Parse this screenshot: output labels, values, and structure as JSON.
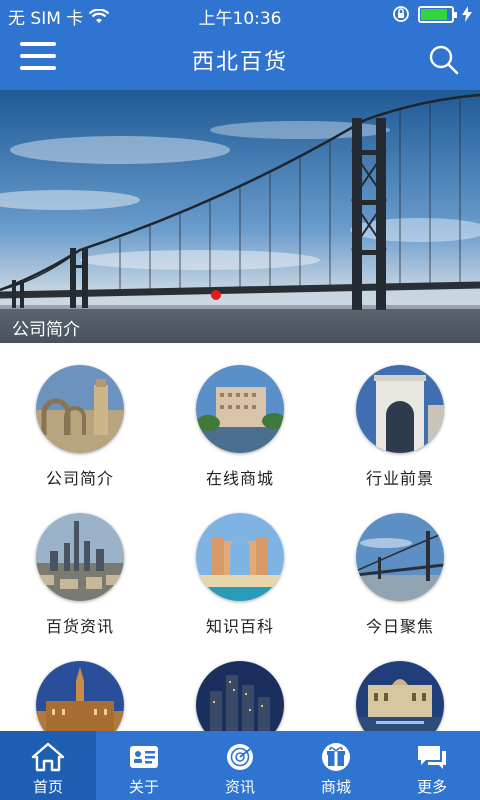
{
  "status": {
    "carrier": "无 SIM 卡",
    "time": "上午10:36",
    "battery_level": 0.85
  },
  "header": {
    "title": "西北百货",
    "menu_icon": "hamburger-menu-icon",
    "search_icon": "search-icon"
  },
  "banner": {
    "caption": "公司简介",
    "active_slide": 1
  },
  "grid": [
    {
      "label": "公司简介",
      "image": "arches-and-tower"
    },
    {
      "label": "在线商城",
      "image": "waterfront-hotel"
    },
    {
      "label": "行业前景",
      "image": "white-arch-building"
    },
    {
      "label": "百货资讯",
      "image": "city-skyline"
    },
    {
      "label": "知识百科",
      "image": "resort-beach"
    },
    {
      "label": "今日聚焦",
      "image": "bridge-sky"
    },
    {
      "label": "",
      "image": "gothic-town-hall"
    },
    {
      "label": "",
      "image": "night-skyscrapers"
    },
    {
      "label": "",
      "image": "palace-fountain"
    }
  ],
  "tabs": [
    {
      "label": "首页",
      "icon": "home-icon"
    },
    {
      "label": "关于",
      "icon": "id-card-icon"
    },
    {
      "label": "资讯",
      "icon": "radar-icon"
    },
    {
      "label": "商城",
      "icon": "gift-icon"
    },
    {
      "label": "更多",
      "icon": "chat-bubbles-icon"
    }
  ],
  "colors": {
    "primary": "#2f74d0",
    "primary_active": "#1f5fb3",
    "indicator": "#e31b1b"
  }
}
